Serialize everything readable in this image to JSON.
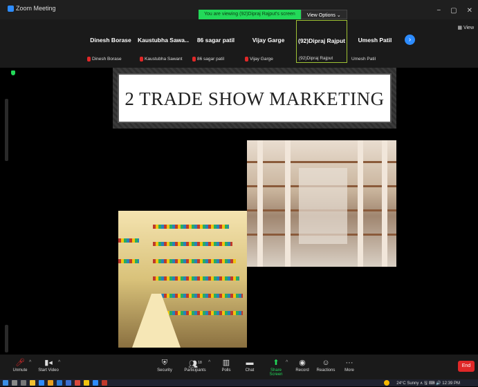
{
  "window": {
    "title": "Zoom Meeting",
    "controls": [
      "−",
      "▢",
      "✕"
    ]
  },
  "share_banner": {
    "viewing_text": "You are viewing (92)Dipraj Rajput's screen",
    "view_options": "View Options ⌄"
  },
  "view_button": "▦ View",
  "gallery": {
    "tiles": [
      {
        "name": "Dinesh Borase",
        "label": "Dinesh Borase",
        "muted": true
      },
      {
        "name": "Kaustubha Sawa...",
        "label": "Kaustubha Sawant",
        "muted": true
      },
      {
        "name": "86 sagar patil",
        "label": "86 sagar patil",
        "muted": true
      },
      {
        "name": "Vijay Garge",
        "label": "Vijay Garge",
        "muted": true
      },
      {
        "name": "(92)Dipraj Rajput",
        "label": "(92)Dipraj Rajput",
        "muted": false
      },
      {
        "name": "Umesh Patil",
        "label": "Umesh Patil",
        "muted": false
      }
    ],
    "next_arrow": "›"
  },
  "slide": {
    "title": "2 TRADE SHOW MARKETING"
  },
  "toolbar": {
    "unmute": "Unmute",
    "start_video": "Start Video",
    "security": "Security",
    "participants": "Participants",
    "participants_count": "18",
    "polls": "Polls",
    "chat": "Chat",
    "share_screen": "Share Screen",
    "record": "Record",
    "reactions": "Reactions",
    "more": "More",
    "end": "End"
  },
  "taskbar": {
    "tray_text": "24°C Sunny ∧ 🖫 ⌨ 🔊 12:39 PM"
  },
  "colors": {
    "accent_blue": "#2d8cff",
    "share_green": "#23d959",
    "end_red": "#e02828",
    "active_tile_border": "#9fc334"
  }
}
